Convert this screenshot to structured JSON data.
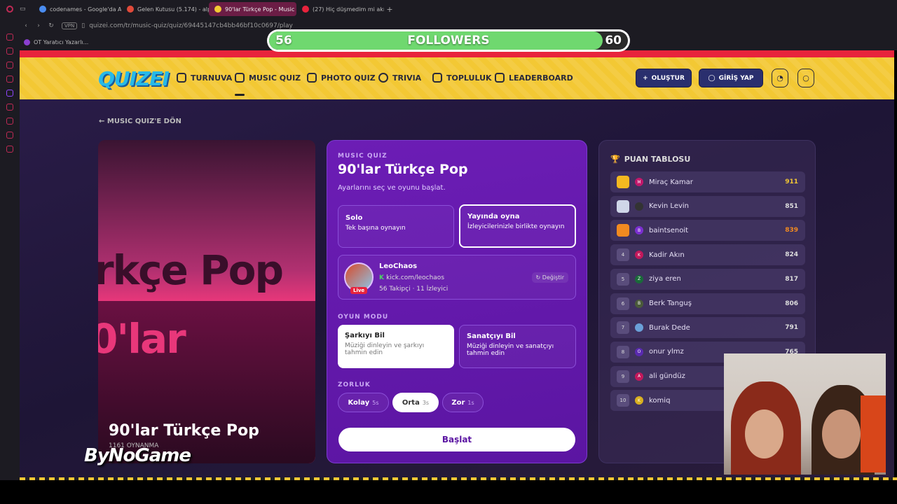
{
  "browser": {
    "tabs": [
      {
        "label": "codenames - Google'da Ar",
        "color": "#4a8cf0"
      },
      {
        "label": "Gelen Kutusu (5.174) - alp",
        "color": "#e04a3a"
      },
      {
        "label": "90'lar Türkçe Pop - Music",
        "color": "#f3c834"
      },
      {
        "label": "(27) Hiç düşmedim mi akın",
        "color": "#e8233c"
      }
    ],
    "url": "quizei.com/tr/music-quiz/quiz/69445147cb4bb46bf10c0697/play",
    "vpn_label": "VPN",
    "bookmark": "OT Yaratıcı Yazarlı..."
  },
  "followers": {
    "current": "56",
    "label": "FOLLOWERS",
    "goal": "60",
    "progress": 0.93
  },
  "site": {
    "logo": "QUIZEI",
    "nav": [
      {
        "label": "TURNUVA",
        "icon": "trophy-icon"
      },
      {
        "label": "MUSIC QUIZ",
        "icon": "music-icon"
      },
      {
        "label": "PHOTO QUIZ",
        "icon": "camera-icon"
      },
      {
        "label": "TRIVIA",
        "icon": "question-icon"
      },
      {
        "label": "TOPLULUK",
        "icon": "users-icon"
      },
      {
        "label": "LEADERBOARD",
        "icon": "award-icon"
      }
    ],
    "create_label": "OLUŞTUR",
    "login_label": "GİRİŞ YAP"
  },
  "back_link": "MUSIC QUIZ'E DÖN",
  "cover": {
    "big_text_1": "rkçe Pop",
    "big_text_2": "0'lar",
    "title": "90'lar Türkçe Pop",
    "plays": "1161 OYNANMA"
  },
  "brand_watermark": "ByNoGame",
  "quiz": {
    "kicker": "MUSIC QUIZ",
    "title": "90'lar Türkçe Pop",
    "subtitle": "Ayarlarını seç ve oyunu başlat.",
    "modes": [
      {
        "title": "Solo",
        "desc": "Tek başına oynayın"
      },
      {
        "title": "Yayında oyna",
        "desc": "İzleyicilerinizle birlikte oynayın"
      }
    ],
    "streamer": {
      "name": "LeoChaos",
      "url": "kick.com/leochaos",
      "stats": "56 Takipçi · 11 İzleyici",
      "live": "Live",
      "change": "Değiştir"
    },
    "game_mode_label": "OYUN MODU",
    "game_modes": [
      {
        "title": "Şarkıyı Bil",
        "desc": "Müziği dinleyin ve şarkıyı tahmin edin"
      },
      {
        "title": "Sanatçıyı Bil",
        "desc": "Müziği dinleyin ve sanatçıyı tahmin edin"
      }
    ],
    "difficulty_label": "ZORLUK",
    "difficulties": [
      {
        "label": "Kolay",
        "time": "5s"
      },
      {
        "label": "Orta",
        "time": "3s"
      },
      {
        "label": "Zor",
        "time": "1s"
      }
    ],
    "start": "Başlat"
  },
  "leaderboard": {
    "title": "PUAN TABLOSU",
    "rows": [
      {
        "rank": "1",
        "initial": "M",
        "name": "Miraç Kamar",
        "score": "911",
        "color": "#c2186b"
      },
      {
        "rank": "2",
        "initial": "",
        "name": "Kevin Levin",
        "score": "851",
        "color": "#333"
      },
      {
        "rank": "3",
        "initial": "B",
        "name": "baintsenoit",
        "score": "839",
        "color": "#7b2fd0"
      },
      {
        "rank": "4",
        "initial": "K",
        "name": "Kadir Akın",
        "score": "824",
        "color": "#c2185b"
      },
      {
        "rank": "5",
        "initial": "Z",
        "name": "ziya eren",
        "score": "817",
        "color": "#1a6a3a"
      },
      {
        "rank": "6",
        "initial": "B",
        "name": "Berk Tanguş",
        "score": "806",
        "color": "#4a5a3a"
      },
      {
        "rank": "7",
        "initial": "",
        "name": "Burak Dede",
        "score": "791",
        "color": "#6aa0d8"
      },
      {
        "rank": "8",
        "initial": "O",
        "name": "onur ylmz",
        "score": "765",
        "color": "#5a2ab0"
      },
      {
        "rank": "9",
        "initial": "A",
        "name": "ali gündüz",
        "score": "",
        "color": "#c2185b"
      },
      {
        "rank": "10",
        "initial": "K",
        "name": "komiq",
        "score": "",
        "color": "#d8b020"
      }
    ]
  }
}
